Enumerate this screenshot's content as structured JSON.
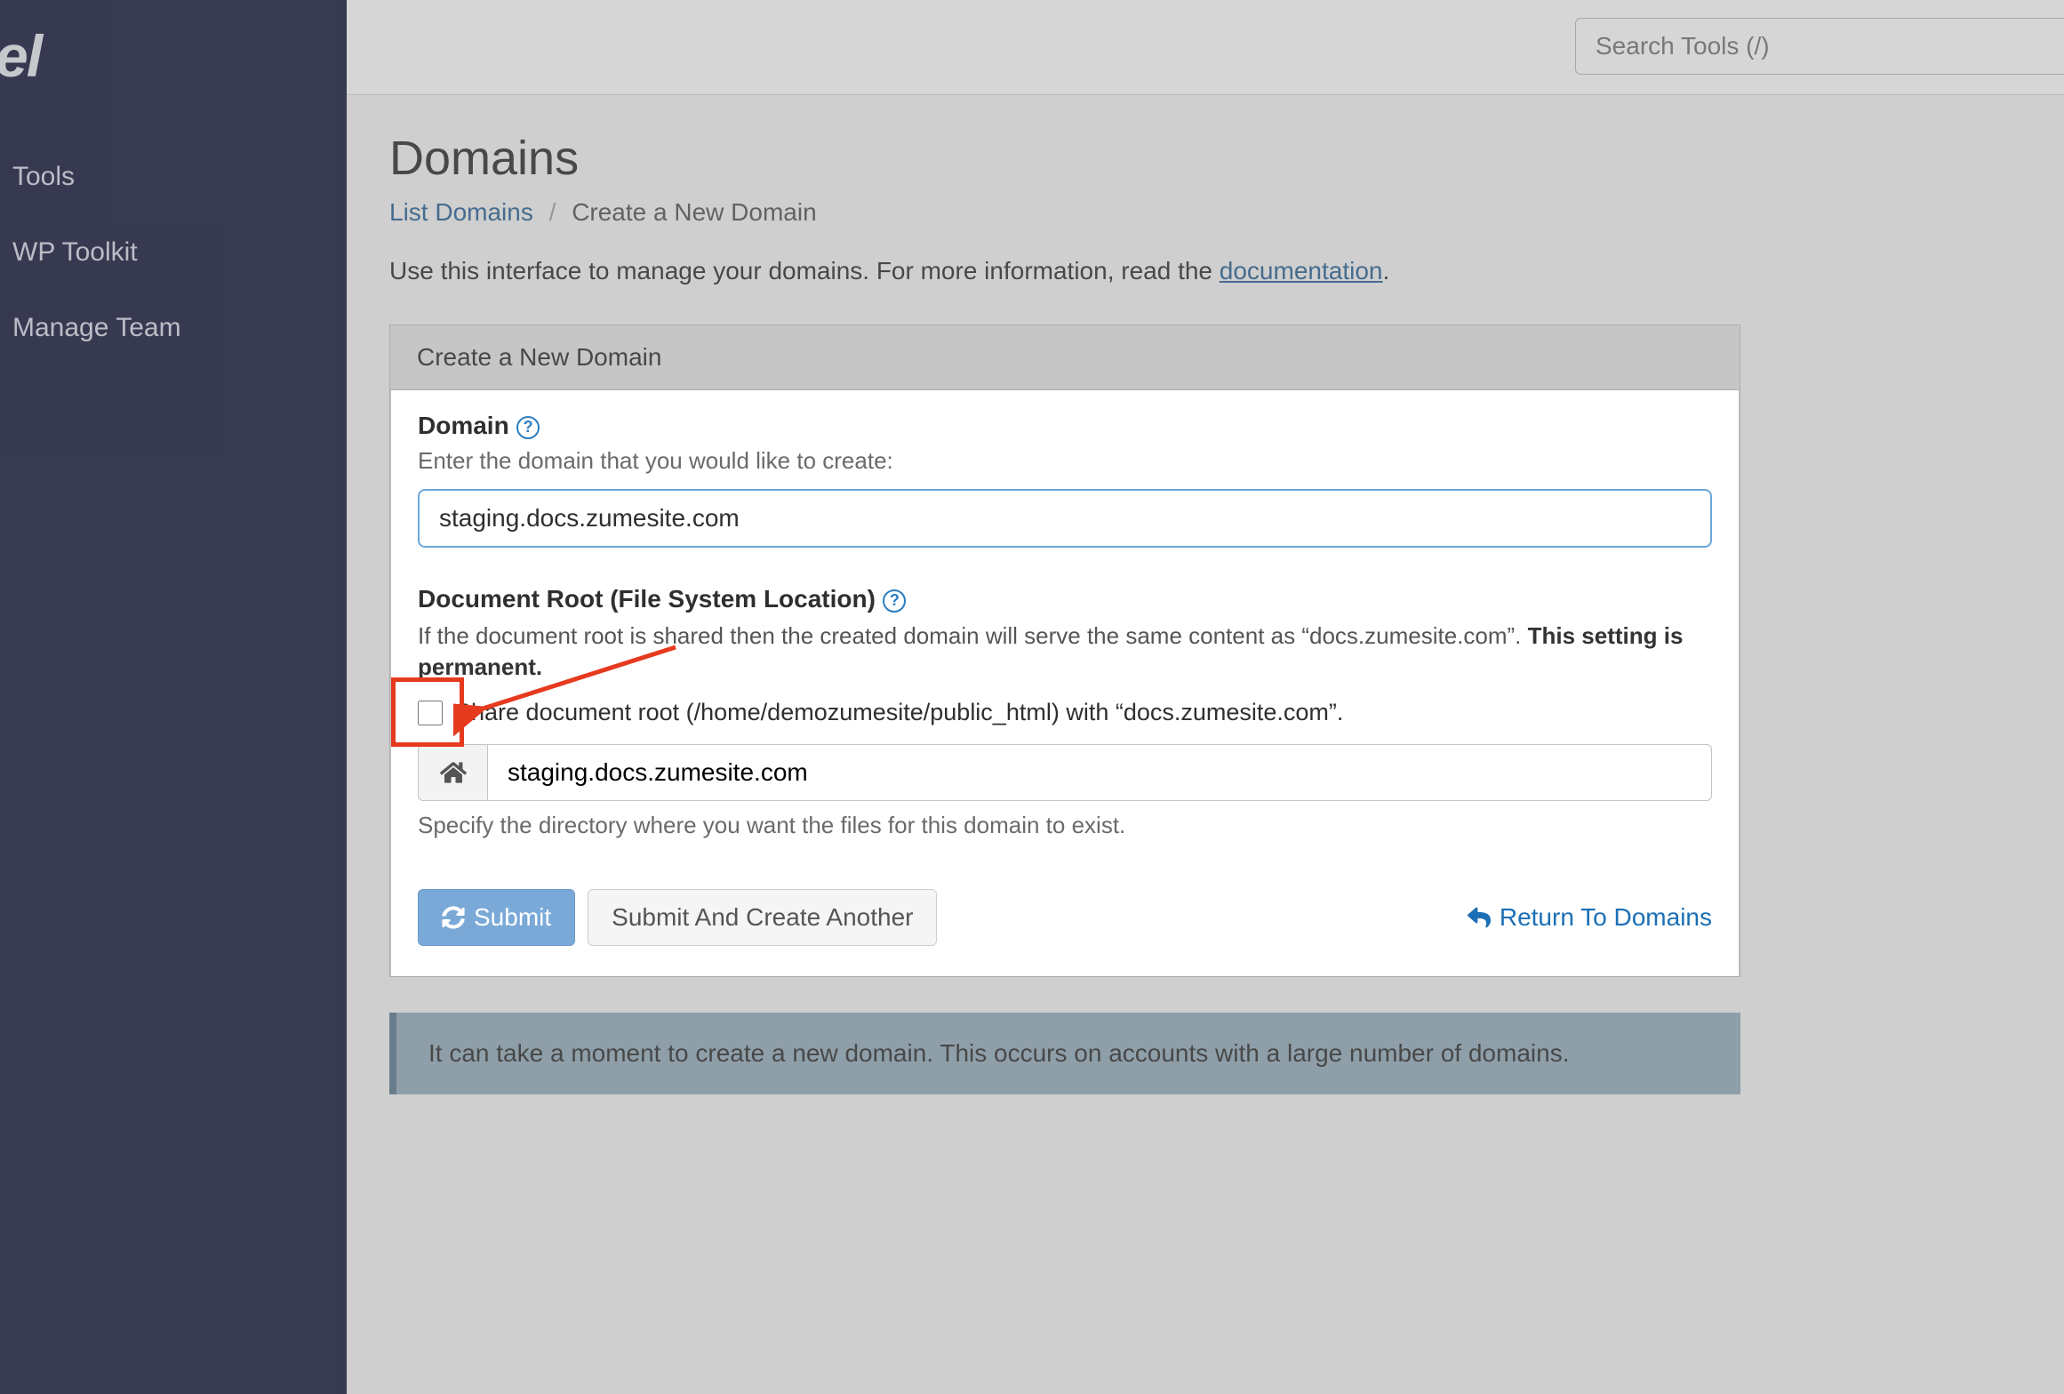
{
  "logo_text": "Panel",
  "sidebar": {
    "items": [
      {
        "label": "Tools"
      },
      {
        "label": "WP Toolkit"
      },
      {
        "label": "Manage Team"
      }
    ]
  },
  "search": {
    "placeholder": "Search Tools (/)"
  },
  "page": {
    "title": "Domains",
    "breadcrumb_list": "List Domains",
    "breadcrumb_sep": "/",
    "breadcrumb_current": "Create a New Domain",
    "intro_pre": "Use this interface to manage your domains. For more information, read the ",
    "intro_link": "documentation",
    "intro_post": "."
  },
  "panel": {
    "heading": "Create a New Domain",
    "domain_label": "Domain",
    "domain_hint": "Enter the domain that you would like to create:",
    "domain_value": "staging.docs.zumesite.com",
    "docroot_label": "Document Root (File System Location)",
    "docroot_desc_pre": "If the document root is shared then the created domain will serve the same content as “docs.zumesite.com”. ",
    "docroot_desc_strong": "This setting is permanent.",
    "share_label": "Share document root (/home/demozumesite/public_html) with “docs.zumesite.com”.",
    "docroot_value": "staging.docs.zumesite.com",
    "docroot_spec": "Specify the directory where you want the files for this domain to exist.",
    "submit_label": "Submit",
    "submit_another_label": "Submit And Create Another",
    "return_label": "Return To Domains"
  },
  "alert": {
    "text": "It can take a moment to create a new domain. This occurs on accounts with a large number of domains."
  }
}
